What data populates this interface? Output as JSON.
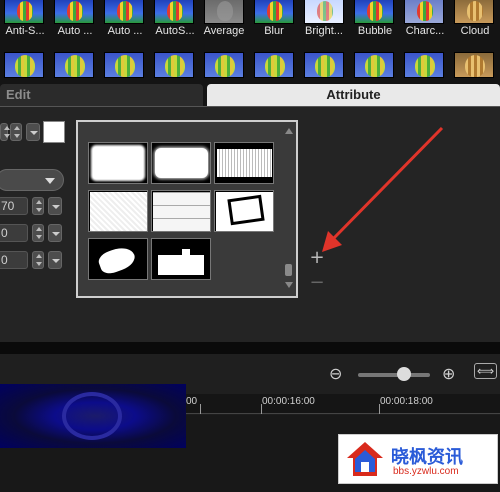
{
  "filters": {
    "labels": [
      "Anti-S...",
      "Auto ...",
      "Auto ...",
      "AutoS...",
      "Average",
      "Blur",
      "Bright...",
      "Bubble",
      "Charc...",
      "Cloud"
    ]
  },
  "tabs": {
    "edit": "Edit",
    "attribute": "Attribute"
  },
  "attributes": {
    "value_70": "70",
    "value_0a": "0",
    "value_0b": "0"
  },
  "mask_popup": {
    "masks": [
      "mask-rough-frame",
      "mask-brush-edge",
      "mask-torn-paper",
      "mask-soft-noise",
      "mask-puzzle",
      "mask-photo-frame",
      "mask-paint-splash",
      "mask-cityscape"
    ]
  },
  "buttons": {
    "add": "+",
    "remove": "−"
  },
  "timeline": {
    "ticks": [
      "00",
      "00:00:16:00",
      "00:00:18:00"
    ]
  },
  "watermark": {
    "title": "晓枫资讯",
    "url": "bbs.yzwlu.com"
  },
  "colors": {
    "accent_red": "#e0342a",
    "tab_active": "#e9e9e9",
    "clip_blue": "#0c0c8a"
  }
}
